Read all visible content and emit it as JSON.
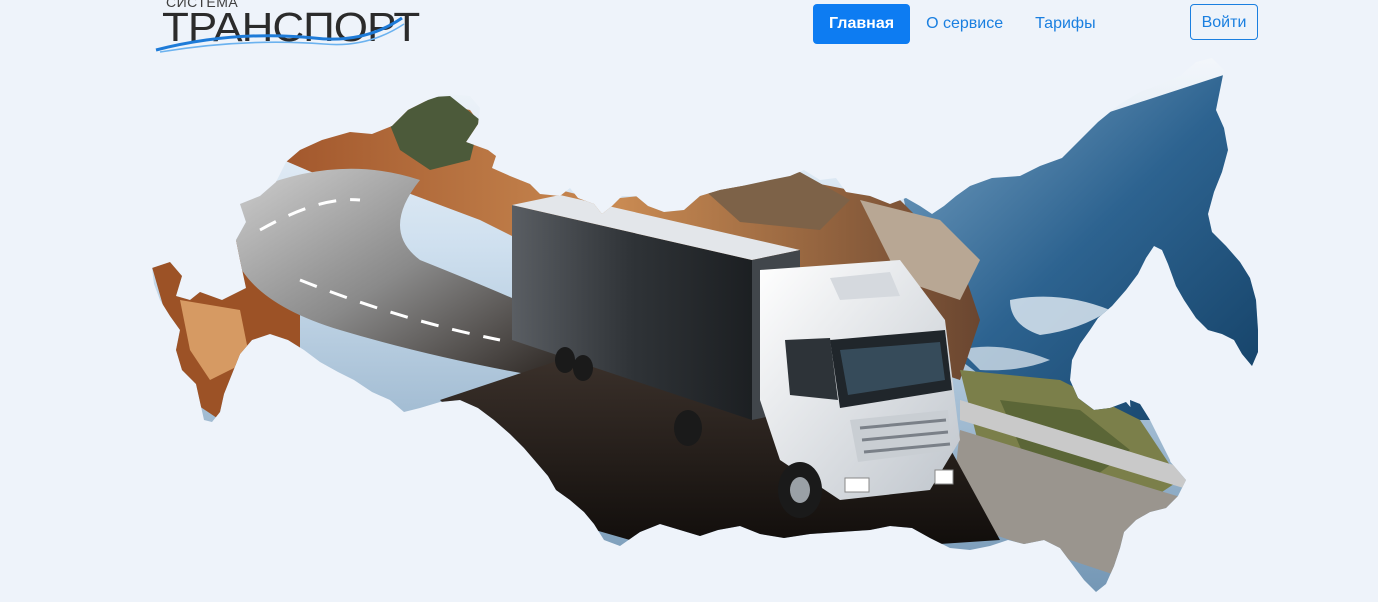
{
  "header": {
    "logo_small": "СИСТЕМА",
    "logo_big": "ТРАНСПОРТ"
  },
  "nav": {
    "items": [
      {
        "label": "Главная",
        "active": true
      },
      {
        "label": "О сервисе",
        "active": false
      },
      {
        "label": "Тарифы",
        "active": false
      }
    ]
  },
  "login_button": "Войти",
  "colors": {
    "accent": "#0d7cf2",
    "link": "#1a7fe0",
    "background": "#eef3fa"
  },
  "hero": {
    "image": "map-of-russia-with-truck-on-coastal-road"
  }
}
